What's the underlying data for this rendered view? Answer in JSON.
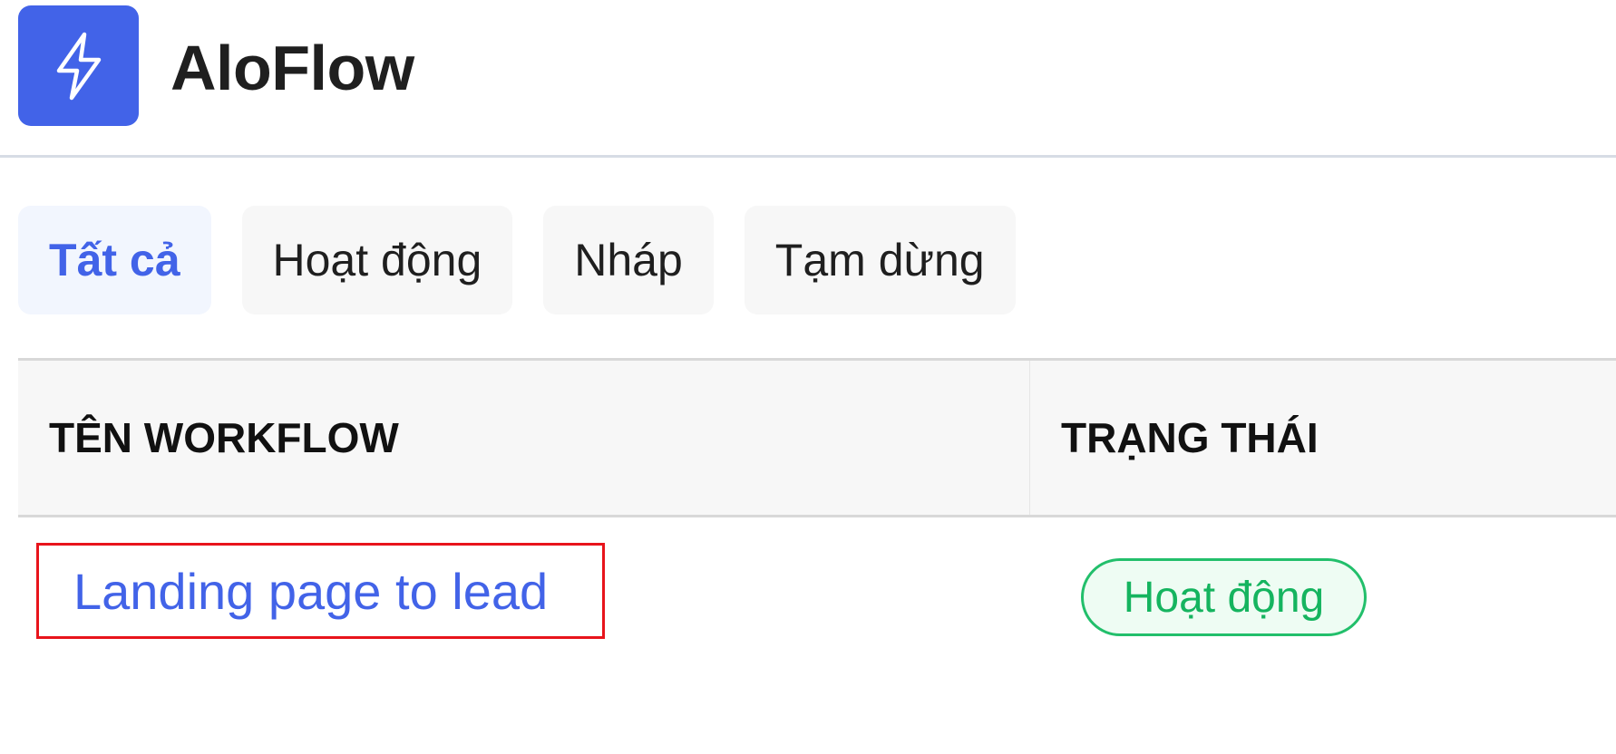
{
  "app": {
    "name": "AloFlow",
    "logo_icon": "lightning-bolt-icon",
    "brand_color": "#4263e8"
  },
  "tabs": [
    {
      "label": "Tất cả",
      "active": true
    },
    {
      "label": "Hoạt động",
      "active": false
    },
    {
      "label": "Nháp",
      "active": false
    },
    {
      "label": "Tạm dừng",
      "active": false
    }
  ],
  "table": {
    "columns": [
      "TÊN WORKFLOW",
      "TRẠNG THÁI"
    ],
    "rows": [
      {
        "name": "Landing page to lead",
        "status": "Hoạt động",
        "status_color": "#22bf6b"
      }
    ]
  }
}
